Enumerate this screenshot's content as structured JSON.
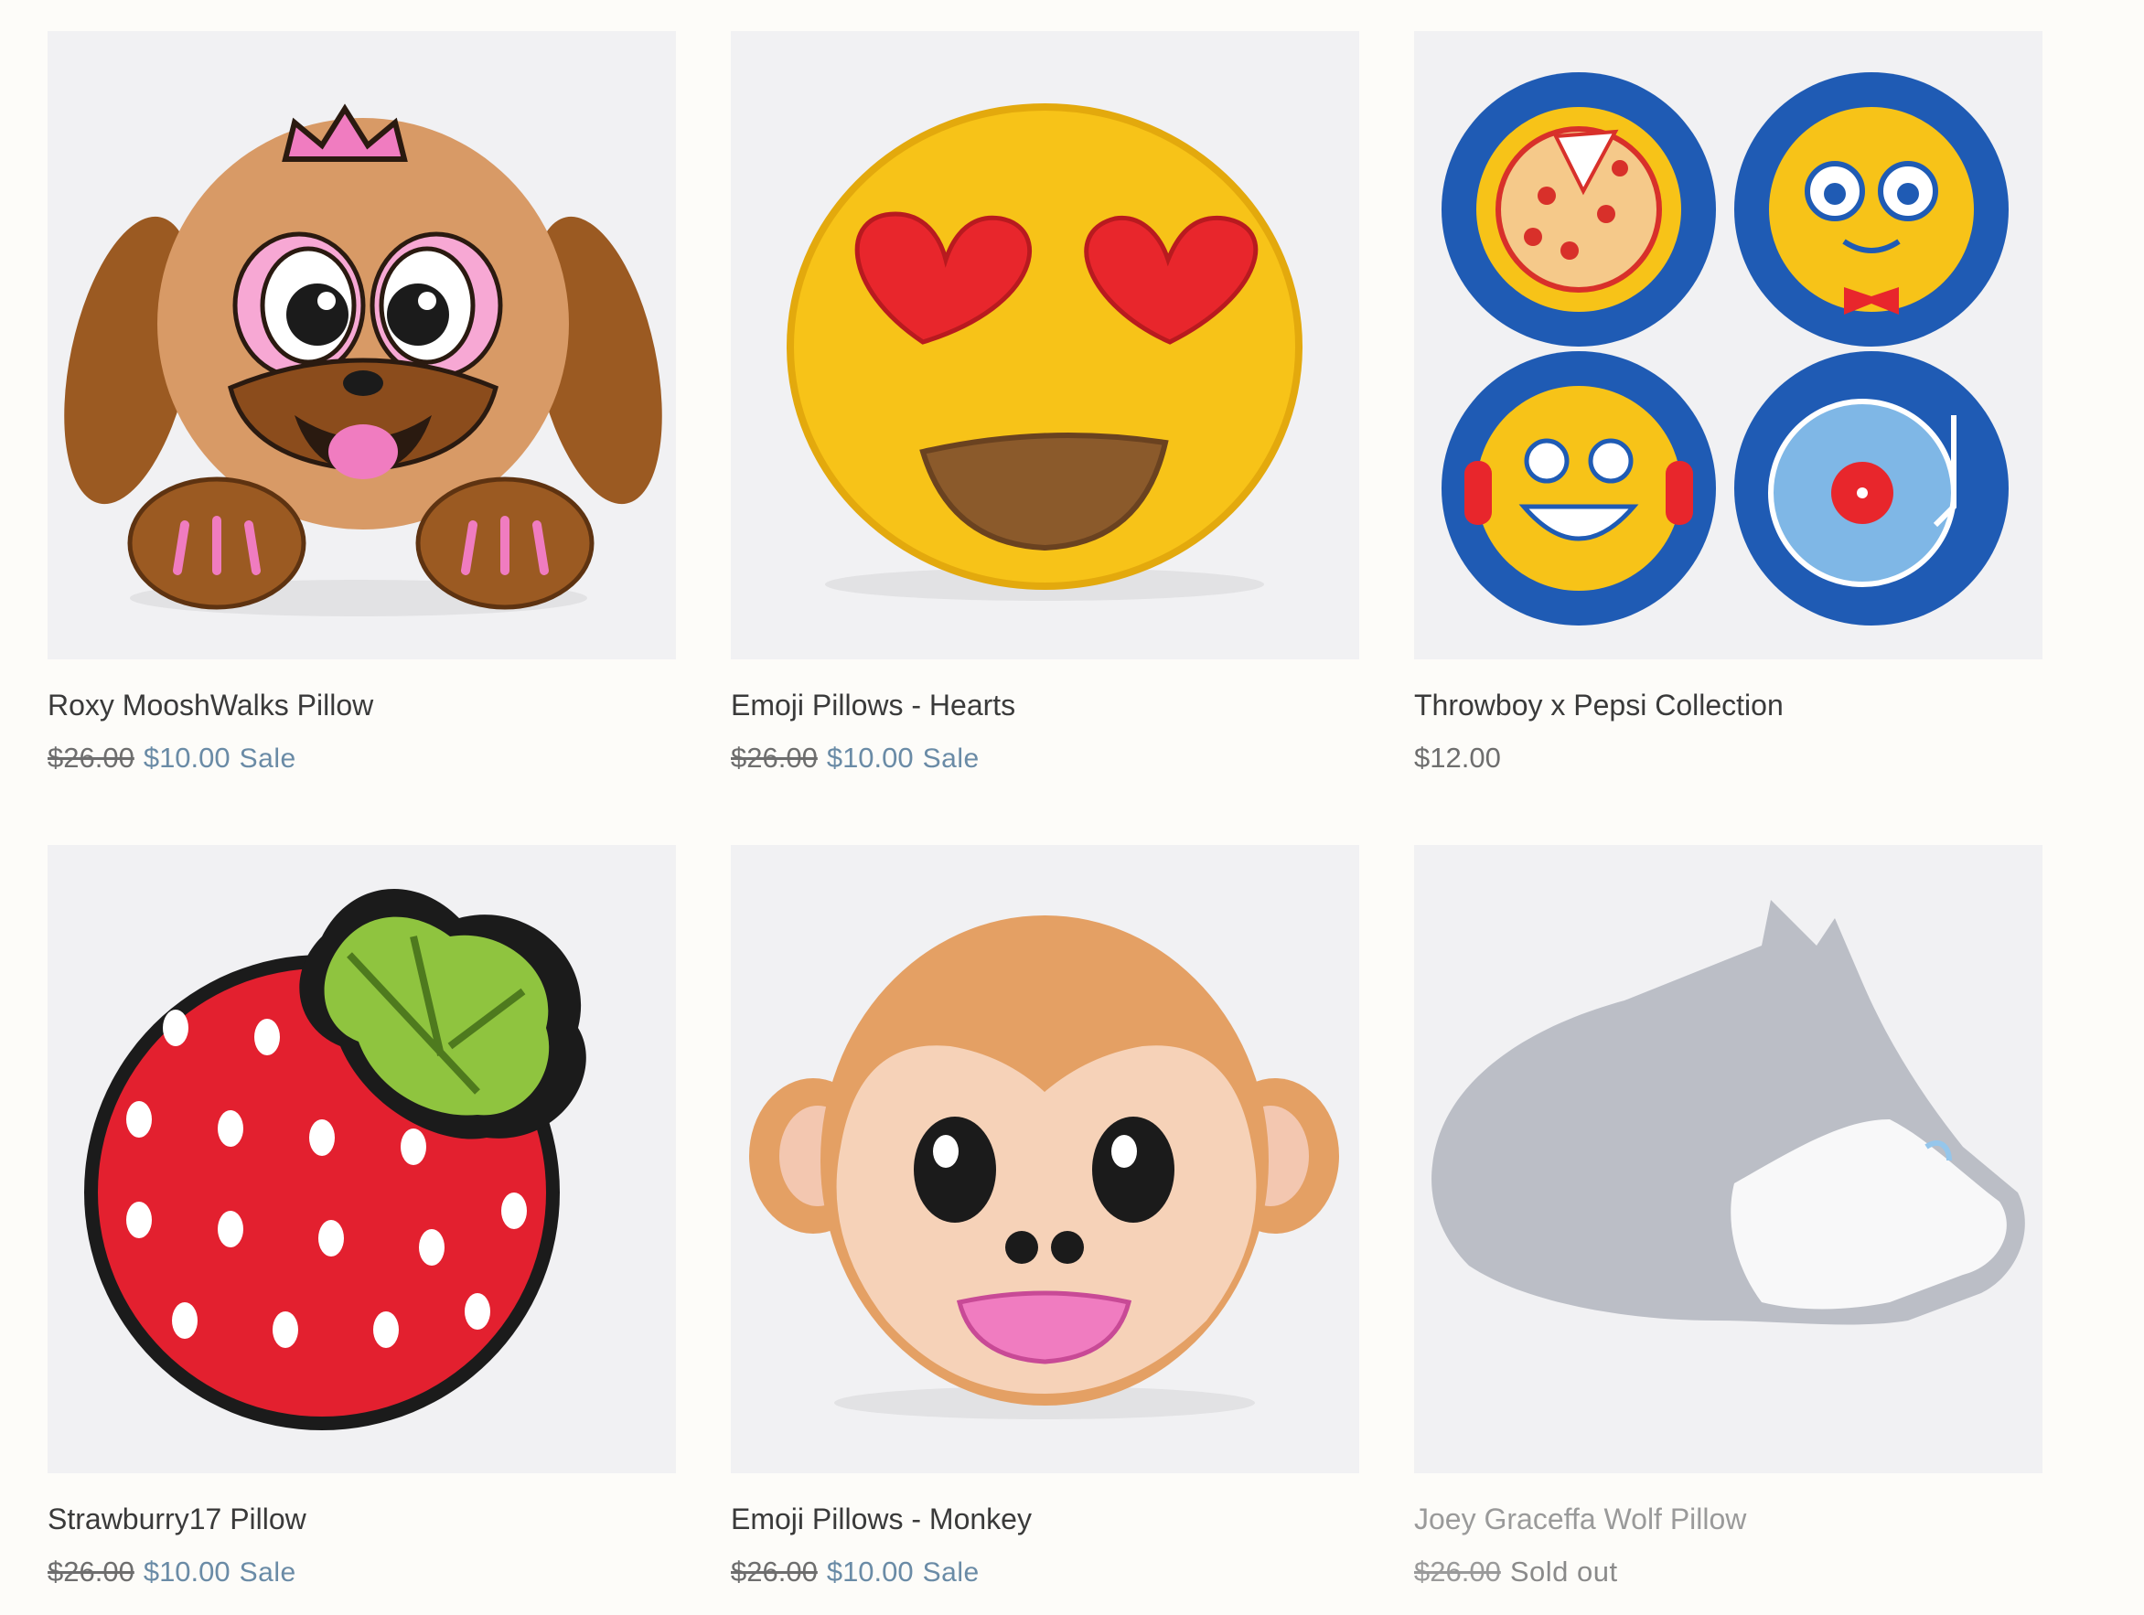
{
  "products": [
    {
      "title": "Roxy MooshWalks Pillow",
      "compare_price": "$26.00",
      "price": "$10.00",
      "badge": "Sale"
    },
    {
      "title": "Emoji Pillows - Hearts",
      "compare_price": "$26.00",
      "price": "$10.00",
      "badge": "Sale"
    },
    {
      "title": "Throwboy x Pepsi Collection",
      "price": "$12.00"
    },
    {
      "title": "Strawburry17 Pillow",
      "compare_price": "$26.00",
      "price": "$10.00",
      "badge": "Sale"
    },
    {
      "title": "Emoji Pillows - Monkey",
      "compare_price": "$26.00",
      "price": "$10.00",
      "badge": "Sale"
    },
    {
      "title": "Joey Graceffa Wolf Pillow",
      "compare_price": "$26.00",
      "badge": "Sold out"
    }
  ],
  "colors": {
    "page_bg": "#fdfcf9",
    "image_bg": "#f1f1f3",
    "sale": "#6a8ba6",
    "text": "#3a3a3a",
    "muted": "#6e6e6e"
  }
}
